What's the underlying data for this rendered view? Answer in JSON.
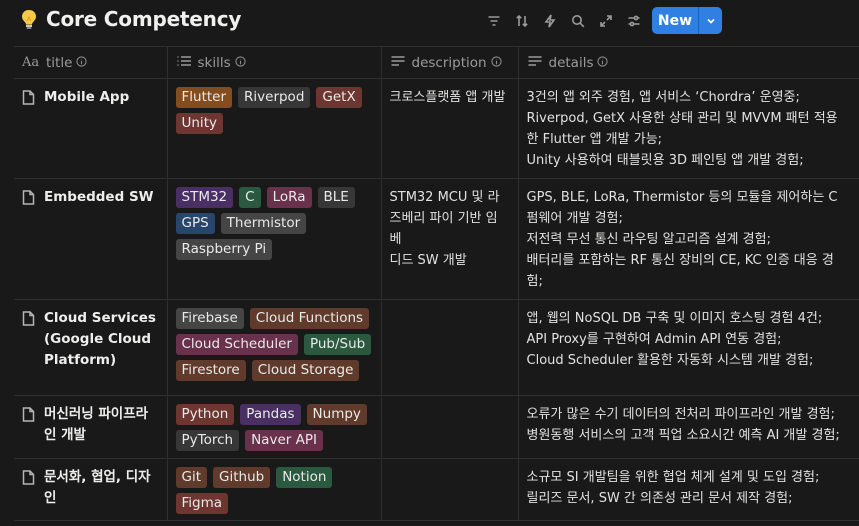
{
  "header": {
    "title": "Core Competency",
    "new_label": "New"
  },
  "icons": {
    "title_icon": "lightbulb-icon",
    "toolbar": [
      "filter-icon",
      "sort-icon",
      "automation-bolt-icon",
      "search-icon",
      "expand-icon",
      "settings-sliders-icon"
    ],
    "new_dropdown": "chevron-down-icon"
  },
  "columns": [
    {
      "label": "title",
      "icon": "text-aa-icon"
    },
    {
      "label": "skills",
      "icon": "list-icon"
    },
    {
      "label": "description",
      "icon": "lines-icon"
    },
    {
      "label": "details",
      "icon": "lines-icon"
    }
  ],
  "tag_colors": {
    "brown": "#603b2c",
    "gray": "#373737",
    "red": "#6e3630",
    "purple": "#492f64",
    "pink": "#69314c",
    "blue": "#28456c",
    "green": "#2b593f",
    "orange": "#854c1d"
  },
  "rows": [
    {
      "title": "Mobile App",
      "skills": [
        {
          "label": "Flutter",
          "color": "#854c1d"
        },
        {
          "label": "Riverpod",
          "color": "#373737"
        },
        {
          "label": "GetX",
          "color": "#6e3630"
        },
        {
          "label": "Unity",
          "color": "#6e3630"
        }
      ],
      "description": [
        "크로스플랫폼 앱 개발"
      ],
      "details": [
        "3건의 앱 외주 경험, 앱 서비스 ‘Chordra’ 운영중;",
        "Riverpod, GetX 사용한 상태 관리 및 MVVM 패턴 적용",
        "한 Flutter 앱 개발 가능;",
        "Unity 사용하여 태블릿용 3D 페인팅 앱 개발 경험;"
      ]
    },
    {
      "title": "Embedded SW",
      "skills": [
        {
          "label": "STM32",
          "color": "#492f64"
        },
        {
          "label": "C",
          "color": "#2b593f"
        },
        {
          "label": "LoRa",
          "color": "#69314c"
        },
        {
          "label": "BLE",
          "color": "#373737"
        },
        {
          "label": "GPS",
          "color": "#28456c"
        },
        {
          "label": "Thermistor",
          "color": "#454545"
        },
        {
          "label": "Raspberry Pi",
          "color": "#454545"
        }
      ],
      "description": [
        "STM32 MCU 및 라",
        "즈베리 파이 기반 임베",
        "디드 SW 개발"
      ],
      "details": [
        "GPS, BLE, LoRa, Thermistor 등의 모듈을 제어하는 C",
        "펌웨어 개발 경험;",
        "저전력 무선 통신 라우팅 알고리즘 설계 경험;",
        "배터리를 포함하는 RF 통신 장비의 CE, KC 인증 대응 경",
        "험;"
      ]
    },
    {
      "title": "Cloud Services (Google Cloud Platform)",
      "title_lines": [
        "Cloud Services",
        "(Google Cloud",
        "Platform)"
      ],
      "skills": [
        {
          "label": "Firebase",
          "color": "#454545"
        },
        {
          "label": "Cloud Functions",
          "color": "#603b2c"
        },
        {
          "label": "Cloud Scheduler",
          "color": "#69314c"
        },
        {
          "label": "Pub/Sub",
          "color": "#2b593f"
        },
        {
          "label": "Firestore",
          "color": "#603b2c"
        },
        {
          "label": "Cloud Storage",
          "color": "#603b2c"
        }
      ],
      "description": [],
      "details": [
        "앱, 웹의 NoSQL DB 구축 및 이미지 호스팅 경험 4건;",
        "API Proxy를 구현하여 Admin API 연동 경험;",
        "Cloud Scheduler 활용한 자동화 시스템 개발 경험;"
      ]
    },
    {
      "title": "머신러닝 파이프라인 개발",
      "title_lines": [
        "머신러닝 파이프라",
        "인 개발"
      ],
      "skills": [
        {
          "label": "Python",
          "color": "#6e3630"
        },
        {
          "label": "Pandas",
          "color": "#492f64"
        },
        {
          "label": "Numpy",
          "color": "#603b2c"
        },
        {
          "label": "PyTorch",
          "color": "#373737"
        },
        {
          "label": "Naver API",
          "color": "#69314c"
        }
      ],
      "description": [],
      "details": [
        "오류가 많은 수기 데이터의 전처리 파이프라인 개발 경험;",
        "병원동행 서비스의 고객 픽업 소요시간 예측 AI 개발 경험;"
      ]
    },
    {
      "title": "문서화, 협업, 디자인",
      "title_lines": [
        "문서화, 협업, 디자",
        "인"
      ],
      "skills": [
        {
          "label": "Git",
          "color": "#603b2c"
        },
        {
          "label": "Github",
          "color": "#603b2c"
        },
        {
          "label": "Notion",
          "color": "#2b593f"
        },
        {
          "label": "Figma",
          "color": "#6e3630"
        }
      ],
      "description": [],
      "details": [
        "소규모 SI 개발팀을 위한 협업 체계 설계 및 도입 경험;",
        "릴리즈 문서, SW 간 의존성 관리 문서 제작 경험;"
      ]
    }
  ]
}
